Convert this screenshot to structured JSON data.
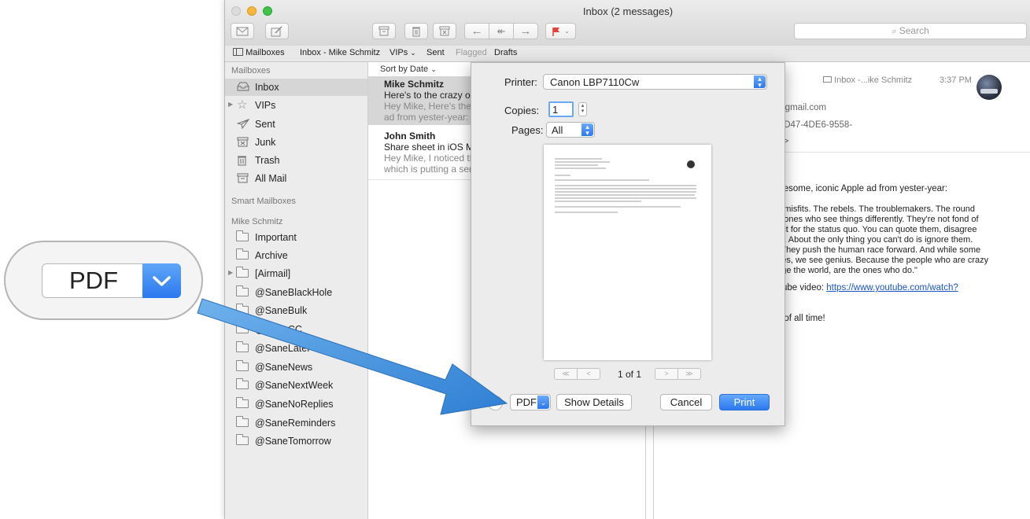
{
  "window": {
    "title": "Inbox (2 messages)",
    "search_placeholder": "Search",
    "favorites": {
      "mailboxes": "Mailboxes",
      "inbox": "Inbox - Mike Schmitz",
      "vips": "VIPs",
      "sent": "Sent",
      "flagged": "Flagged",
      "drafts": "Drafts"
    }
  },
  "sidebar": {
    "section_mailboxes": "Mailboxes",
    "mailboxes": [
      {
        "label": "Inbox",
        "icon": "inbox-icon"
      },
      {
        "label": "VIPs",
        "icon": "star-icon"
      },
      {
        "label": "Sent",
        "icon": "paper-plane-icon"
      },
      {
        "label": "Junk",
        "icon": "junk-icon"
      },
      {
        "label": "Trash",
        "icon": "trash-icon"
      },
      {
        "label": "All Mail",
        "icon": "archive-box-icon"
      }
    ],
    "section_smart": "Smart Mailboxes",
    "section_account": "Mike Schmitz",
    "folders": [
      "Important",
      "Archive",
      "[Airmail]",
      "@SaneBlackHole",
      "@SaneBulk",
      "@SaneCC",
      "@SaneLater",
      "@SaneNews",
      "@SaneNextWeek",
      "@SaneNoReplies",
      "@SaneReminders",
      "@SaneTomorrow"
    ]
  },
  "message_list": {
    "sort_label": "Sort by Date",
    "messages": [
      {
        "sender": "Mike Schmitz",
        "subject": "Here's to the crazy ones",
        "preview1": "Hey Mike, Here's the poem from that",
        "preview2": "ad from yester-year: \"Here's to the"
      },
      {
        "sender": "John Smith",
        "subject": "Share sheet in iOS Mail",
        "preview1": "Hey Mike, I noticed that the share sheet",
        "preview2": "which is putting a serious damper on"
      }
    ]
  },
  "reading_pane": {
    "mailbox_tag": "Inbox -...ike Schmitz",
    "time": "3:37 PM",
    "header_line1": "@gmail.com",
    "header_line2": "-3D47-4DE6-9558-",
    "header_line3": "m>",
    "body_intro": "awesome, iconic Apple ad from yester-year:",
    "body_lines": [
      "he misfits. The rebels. The troublemakers. The round",
      "he ones who see things differently. They're not fond of",
      "pect for the status quo. You can quote them, disagree",
      "em. About the only thing you can't do is ignore them.",
      "s. They push the human race forward. And while some",
      "ones, we see genius. Because the people who are crazy",
      "ange the world, are the ones who do.\""
    ],
    "link_prefix": "uTube video: ",
    "link_text": "https://www.youtube.com/watch?",
    "closing": "ds of all time!"
  },
  "print_dialog": {
    "printer_label": "Printer:",
    "printer_value": "Canon LBP7110Cw",
    "copies_label": "Copies:",
    "copies_value": "1",
    "pages_label": "Pages:",
    "pages_value": "All",
    "page_indicator": "1 of 1",
    "help": "?",
    "pdf_label": "PDF",
    "show_details": "Show Details",
    "cancel": "Cancel",
    "print": "Print"
  },
  "callout": {
    "pdf_label": "PDF"
  },
  "colors": {
    "accent_blue": "#2b78ef",
    "arrow_blue": "#3b8fdc",
    "selection_gray": "#d6d6d6",
    "link_blue": "#1a56c4"
  }
}
